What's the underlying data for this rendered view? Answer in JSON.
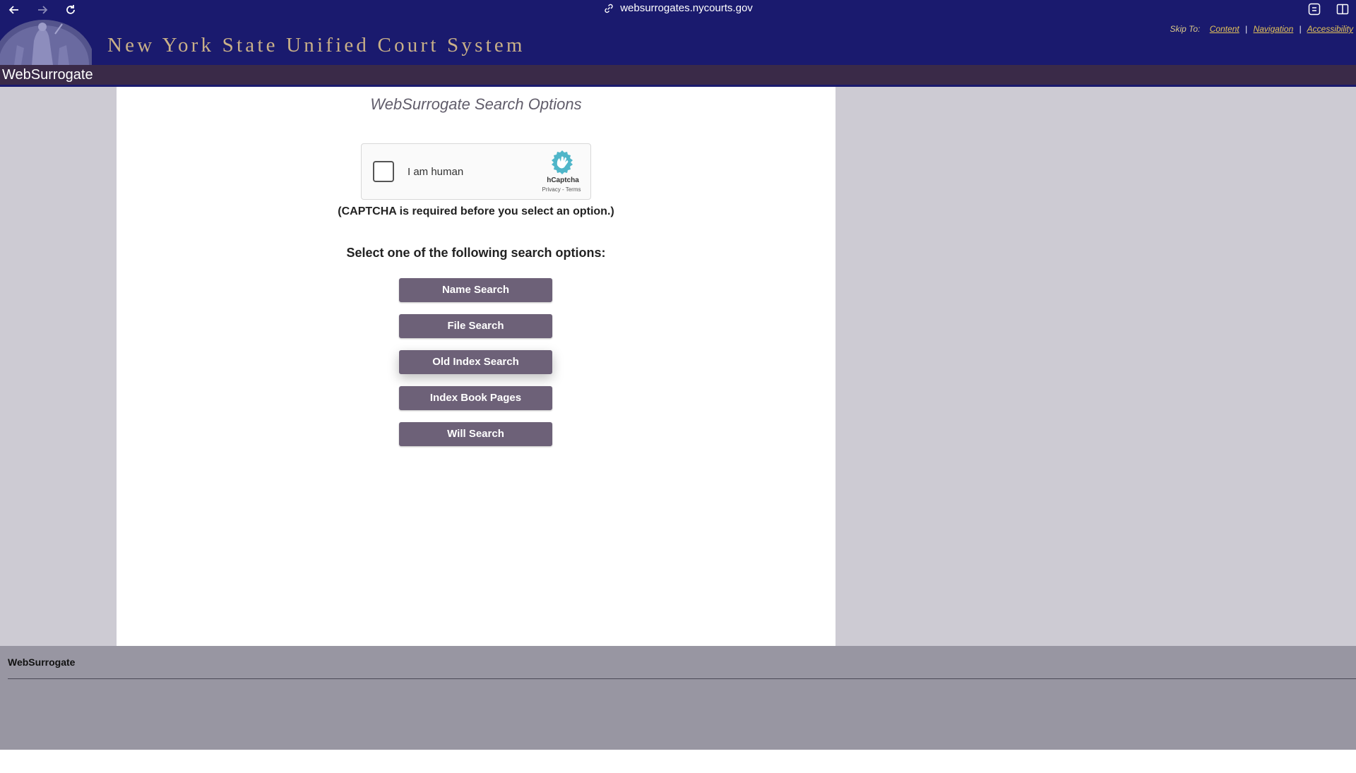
{
  "browser": {
    "url": "websurrogates.nycourts.gov",
    "back_icon": "arrow-left-icon",
    "forward_icon": "arrow-right-icon",
    "reload_icon": "reload-icon"
  },
  "header": {
    "title": "New York State Unified Court System",
    "skip_to_label": "Skip To:",
    "skip_links": [
      "Content",
      "Navigation",
      "Accessibility"
    ],
    "separator": "|",
    "app_name": "WebSurrogate"
  },
  "main": {
    "title": "WebSurrogate Search Options",
    "captcha": {
      "label": "I am human",
      "brand": "hCaptcha",
      "privacy": "Privacy",
      "dash": "-",
      "terms": "Terms"
    },
    "captcha_note": "(CAPTCHA is required before you select an option.)",
    "select_heading": "Select one of the following search options:",
    "options": [
      "Name Search",
      "File Search",
      "Old Index Search",
      "Index Book Pages",
      "Will Search"
    ]
  },
  "footer": {
    "name": "WebSurrogate"
  },
  "colors": {
    "brand_navy": "#1a1a6e",
    "app_bar": "#3a2a48",
    "button": "#6d6178",
    "side_panel": "#cdcbd3",
    "footer": "#9896a2",
    "title_gold": "#c9b088"
  }
}
